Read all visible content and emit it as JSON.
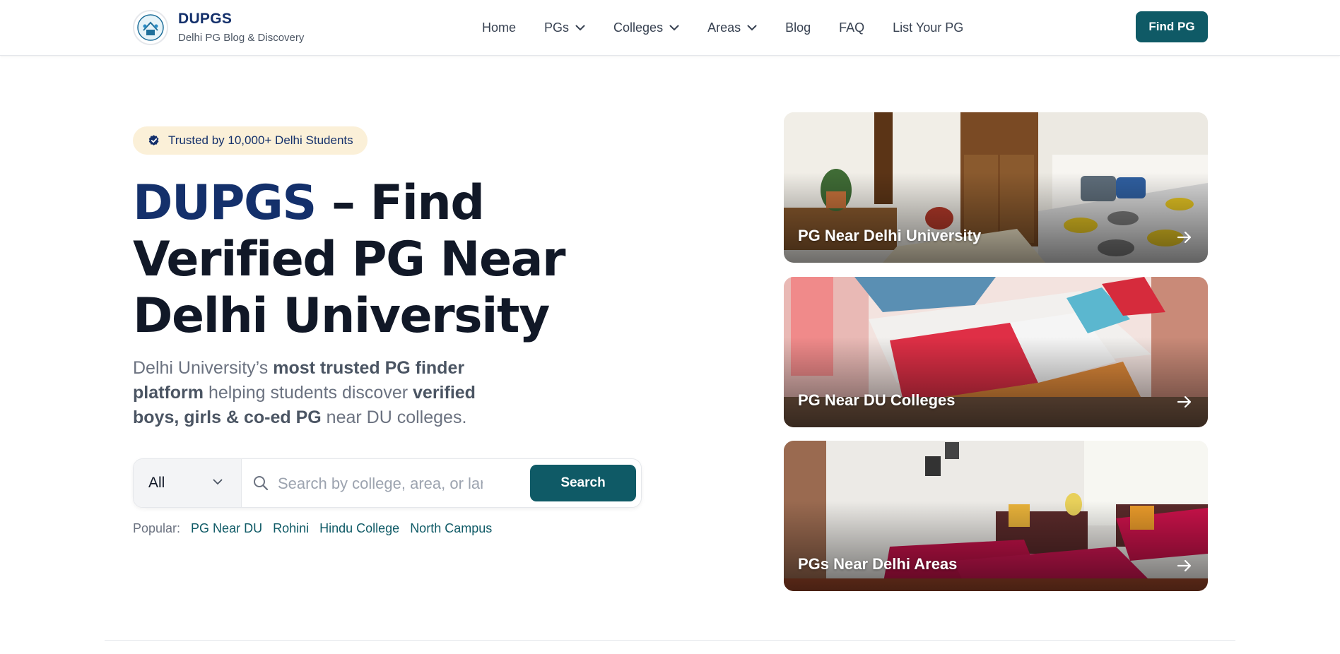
{
  "header": {
    "brand_title": "DUPGS",
    "brand_subtitle": "Delhi PG Blog & Discovery",
    "nav": [
      {
        "label": "Home",
        "dropdown": false
      },
      {
        "label": "PGs",
        "dropdown": true
      },
      {
        "label": "Colleges",
        "dropdown": true
      },
      {
        "label": "Areas",
        "dropdown": true
      },
      {
        "label": "Blog",
        "dropdown": false
      },
      {
        "label": "FAQ",
        "dropdown": false
      },
      {
        "label": "List Your PG",
        "dropdown": false
      }
    ],
    "cta_label": "Find PG"
  },
  "hero": {
    "badge": "Trusted by 10,000+ Delhi Students",
    "title_accent": "DUPGS",
    "title_rest": " – Find Verified PG Near Delhi University",
    "desc": {
      "p1": "Delhi University’s ",
      "b1": "most trusted PG finder platform",
      "p2": " helping students discover ",
      "b2": "verified boys, girls & co-ed PG",
      "p3": " near DU colleges."
    },
    "search": {
      "select_value": "All",
      "placeholder": "Search by college, area, or landmark",
      "button_label": "Search"
    },
    "popular_label": "Popular:",
    "popular_tags": [
      "PG Near DU",
      "Rohini",
      "Hindu College",
      "North Campus"
    ]
  },
  "cards": [
    {
      "title": "PG Near Delhi University"
    },
    {
      "title": "PG Near DU Colleges"
    },
    {
      "title": "PGs Near Delhi Areas"
    }
  ],
  "colors": {
    "brand_navy": "#14306b",
    "primary_teal": "#0f5a66",
    "badge_bg": "#fbf0d8"
  },
  "icons": [
    "logo-icon",
    "chevron-down-icon",
    "verified-check-icon",
    "search-icon",
    "arrow-right-icon"
  ]
}
